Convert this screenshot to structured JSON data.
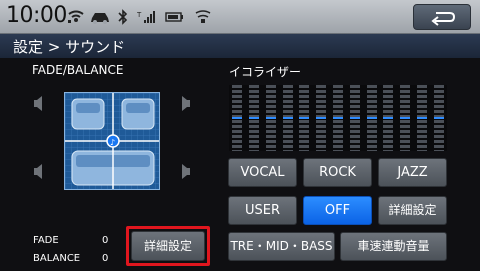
{
  "status": {
    "time": "10:00",
    "icons": [
      "signal-icon",
      "car-icon",
      "bluetooth-icon",
      "cell-signal-icon",
      "battery-icon",
      "gps-signal-icon"
    ]
  },
  "title": "設定 > サウンド",
  "fade_balance": {
    "label": "FADE/BALANCE",
    "fade_label": "FADE",
    "fade_value": "0",
    "balance_label": "BALANCE",
    "balance_value": "0"
  },
  "equalizer": {
    "label": "イコライザー",
    "bands": 13,
    "levels": [
      0.5,
      0.5,
      0.5,
      0.5,
      0.5,
      0.5,
      0.5,
      0.5,
      0.5,
      0.5,
      0.5,
      0.5,
      0.5
    ]
  },
  "presets": {
    "vocal": "VOCAL",
    "rock": "ROCK",
    "jazz": "JAZZ",
    "user": "USER",
    "off": "OFF",
    "detail": "詳細設定"
  },
  "buttons": {
    "fade_detail": "詳細設定",
    "tone": "TRE・MID・BASS",
    "speed_volume": "車速連動音量"
  },
  "colors": {
    "accent": "#1a78f2",
    "highlight": "#e0161e"
  }
}
